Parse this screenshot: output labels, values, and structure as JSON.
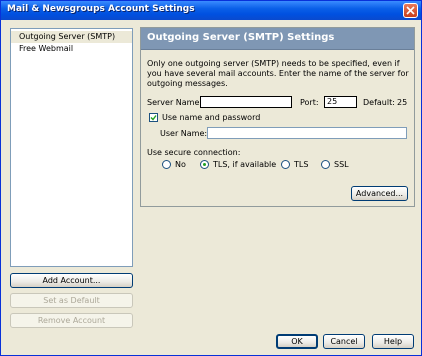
{
  "window": {
    "title": "Mail & Newsgroups Account Settings"
  },
  "sidebar": {
    "accounts": [
      {
        "label": "Outgoing Server (SMTP)",
        "selected": true
      },
      {
        "label": "Free Webmail",
        "selected": false
      }
    ],
    "add_account_label": "Add Account...",
    "set_default_label": "Set as Default",
    "remove_account_label": "Remove Account"
  },
  "panel": {
    "title": "Outgoing Server (SMTP) Settings",
    "description": "Only one outgoing server (SMTP) needs to be specified, even if you have several mail accounts. Enter the name of the server for outgoing messages.",
    "server_name_label": "Server Name:",
    "server_name_value": "",
    "port_label": "Port:",
    "port_value": "25",
    "default_label": "Default:",
    "default_value": "25",
    "use_name_password_label": "Use name and password",
    "use_name_password_checked": true,
    "username_label": "User Name:",
    "username_value": "",
    "secure_connection_label": "Use secure connection:",
    "secure_options": [
      {
        "label": "No",
        "selected": false
      },
      {
        "label": "TLS, if available",
        "selected": true
      },
      {
        "label": "TLS",
        "selected": false
      },
      {
        "label": "SSL",
        "selected": false
      }
    ],
    "advanced_label": "Advanced..."
  },
  "footer": {
    "ok_label": "OK",
    "cancel_label": "Cancel",
    "help_label": "Help"
  },
  "colors": {
    "titlebar": "#0A5FE8",
    "panel_header": "#7F97B4",
    "background": "#ECE9D8",
    "radio_dot": "#21A121"
  }
}
